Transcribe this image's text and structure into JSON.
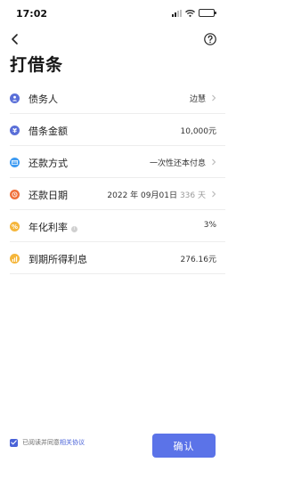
{
  "status_bar": {
    "time": "17:02"
  },
  "page": {
    "title": "打借条"
  },
  "rows": [
    {
      "label": "债务人",
      "value": "边慧",
      "icon": "person-icon",
      "color": "#5a6fd8"
    },
    {
      "label": "借条金额",
      "value": "10,000元",
      "icon": "yen-icon",
      "color": "#5a6fd8"
    },
    {
      "label": "还款方式",
      "value": "一次性还本付息",
      "icon": "card-icon",
      "color": "#3e9bf2"
    },
    {
      "label": "还款日期",
      "value": "2022 年 09月01日",
      "extra": "336 天",
      "icon": "clock-icon",
      "color": "#f0703a"
    },
    {
      "label": "年化利率",
      "value": "3%",
      "icon": "percent-icon",
      "color": "#f5b63b"
    },
    {
      "label": "到期所得利息",
      "value": "276.16元",
      "icon": "bar-chart-icon",
      "color": "#f5b63b"
    }
  ],
  "footer": {
    "agree_text": "已阅读并同意",
    "agree_link": "相关协议",
    "confirm_label": "确认"
  },
  "colors": {
    "accent": "#5b73e8"
  }
}
